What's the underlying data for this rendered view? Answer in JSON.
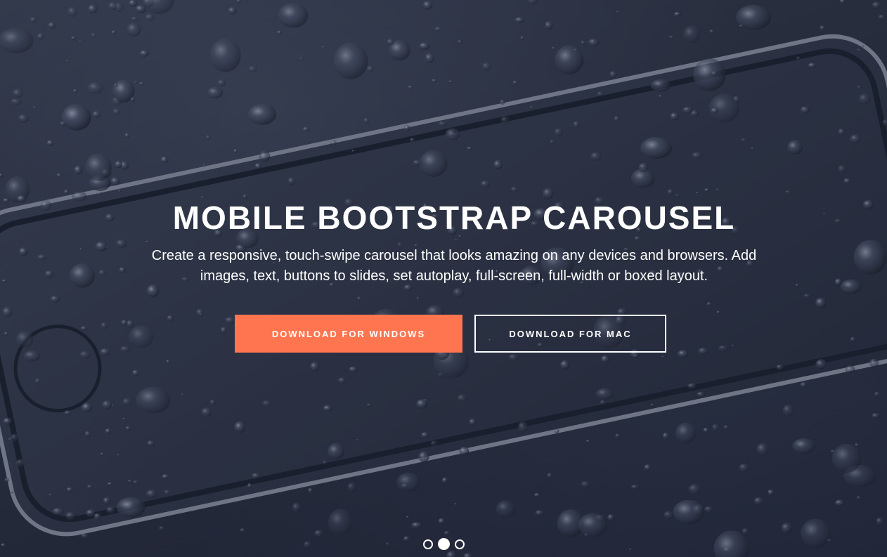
{
  "hero": {
    "title": "MOBILE BOOTSTRAP CAROUSEL",
    "subtitle": "Create a responsive, touch-swipe carousel that looks amazing on any devices and browsers. Add images, text, buttons to slides, set autoplay, full-screen, full-width or boxed layout.",
    "background_image": "wet smartphone with water droplets",
    "accent_color": "#ff7550"
  },
  "buttons": {
    "primary_label": "DOWNLOAD FOR WINDOWS",
    "secondary_label": "DOWNLOAD FOR MAC"
  },
  "carousel": {
    "slide_count": 3,
    "active_index": 1
  }
}
